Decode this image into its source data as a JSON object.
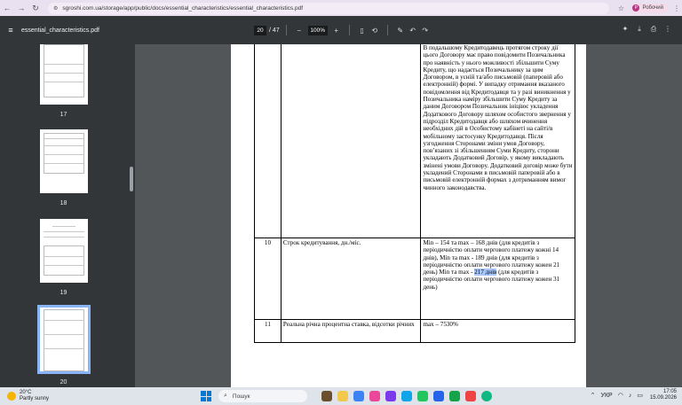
{
  "browser": {
    "url": "sgroshi.com.ua/storage/app/public/docs/essential_characteristics/essential_characteristics.pdf",
    "profile_label": "Робочий",
    "profile_initial": "Р"
  },
  "pdf_toolbar": {
    "file_title": "essential_characteristics.pdf",
    "current_page": "20",
    "total_pages": "/ 47",
    "zoom": "100%"
  },
  "thumbnails": [
    {
      "label": "17"
    },
    {
      "label": "18"
    },
    {
      "label": "19"
    },
    {
      "label": "20"
    }
  ],
  "document": {
    "row_continued_text": "В подальшому Кредитодавець протягом строку дії цього Договору має право повідомити Позичальника про наявність у нього можливості збільшити Суму Кредиту, що надається Позичальнику за цим Договором, в усній та/або письмовій (паперовій або електронній) формі. У випадку отримання вказаного повідомлення від Кредитодавця та у разі виникнення у Позичальника наміру збільшити Суму Кредиту за даним Договором Позичальник ініціює укладення Додаткового Договору шляхом особистого звернення у підрозділ Кредитодавця або шляхом вчинення необхідних дій в Особистому кабінеті на сайті/в мобільному застосунку Кредитодавця. Після узгодження Сторонами зміни умов Договору, пов’язаних зі збільшенням Суми Кредиту, сторони укладають Додатковий Договір, у якому викладають змінені умови Договору. Додатковий договір може бути укладений Сторонами в письмовій паперовій або в письмовій електронній формах з дотриманням вимог чинного законодавства.",
    "rows": [
      {
        "num": "10",
        "label": "Строк кредитування, дн./міс.",
        "value_part1": "Min – 154 та max – 168 днів (для кредитів з періодичністю оплати чергового платежу кожні 14 днів), Min та max - 189 днів (для кредитів з періодичністю оплати чергового платежу кожен 21 день) Min та max - ",
        "value_highlight": "217 днів",
        "value_part2": " (для кредитів з періодичністю оплати чергового платежу кожен 31 день)"
      },
      {
        "num": "11",
        "label": "Реальна річна процентна ставка, відсотки річних",
        "value": "max – 7530%"
      }
    ]
  },
  "taskbar": {
    "temperature": "20°C",
    "weather": "Partly sunny",
    "search_placeholder": "Пошук",
    "language": "УКР",
    "time": "17:05",
    "date": "15.09.2026"
  }
}
